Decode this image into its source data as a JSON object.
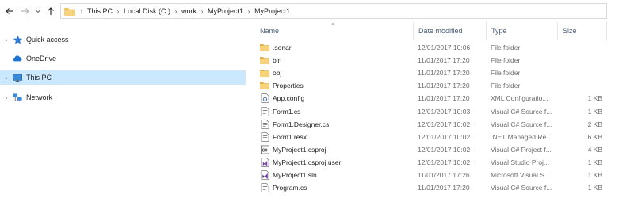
{
  "navigation": {
    "back_icon": "arrow-left-icon",
    "forward_icon": "arrow-right-icon",
    "recent_icon": "chevron-down-icon",
    "up_icon": "arrow-up-icon"
  },
  "breadcrumb": [
    "This PC",
    "Local Disk (C:)",
    "work",
    "MyProject1",
    "MyProject1"
  ],
  "sidebar": {
    "items": [
      {
        "label": "Quick access",
        "icon": "star-icon",
        "selected": false
      },
      {
        "label": "OneDrive",
        "icon": "cloud-icon",
        "selected": false
      },
      {
        "label": "This PC",
        "icon": "monitor-icon",
        "selected": true
      },
      {
        "label": "Network",
        "icon": "network-icon",
        "selected": false
      }
    ]
  },
  "columns": {
    "name": "Name",
    "date": "Date modified",
    "type": "Type",
    "size": "Size"
  },
  "files": [
    {
      "name": ".sonar",
      "date": "12/01/2017 10:06",
      "type": "File folder",
      "size": "",
      "icon": "folder-icon"
    },
    {
      "name": "bin",
      "date": "11/01/2017 17:20",
      "type": "File folder",
      "size": "",
      "icon": "folder-icon"
    },
    {
      "name": "obj",
      "date": "11/01/2017 17:20",
      "type": "File folder",
      "size": "",
      "icon": "folder-icon"
    },
    {
      "name": "Properties",
      "date": "11/01/2017 17:20",
      "type": "File folder",
      "size": "",
      "icon": "folder-icon"
    },
    {
      "name": "App.config",
      "date": "11/01/2017 17:20",
      "type": "XML Configuratio...",
      "size": "1 KB",
      "icon": "config-file-icon"
    },
    {
      "name": "Form1.cs",
      "date": "12/01/2017 10:03",
      "type": "Visual C# Source f...",
      "size": "1 KB",
      "icon": "cs-file-icon"
    },
    {
      "name": "Form1.Designer.cs",
      "date": "12/01/2017 10:02",
      "type": "Visual C# Source f...",
      "size": "2 KB",
      "icon": "cs-file-icon"
    },
    {
      "name": "Form1.resx",
      "date": "12/01/2017 10:02",
      "type": ".NET Managed Re...",
      "size": "6 KB",
      "icon": "resx-file-icon"
    },
    {
      "name": "MyProject1.csproj",
      "date": "12/01/2017 10:02",
      "type": "Visual C# Project f...",
      "size": "4 KB",
      "icon": "csproj-file-icon"
    },
    {
      "name": "MyProject1.csproj.user",
      "date": "12/01/2017 10:02",
      "type": "Visual Studio Proj...",
      "size": "1 KB",
      "icon": "vs-user-file-icon"
    },
    {
      "name": "MyProject1.sln",
      "date": "11/01/2017 17:26",
      "type": "Microsoft Visual S...",
      "size": "1 KB",
      "icon": "sln-file-icon"
    },
    {
      "name": "Program.cs",
      "date": "11/01/2017 17:20",
      "type": "Visual C# Source f...",
      "size": "1 KB",
      "icon": "cs-file-icon"
    }
  ],
  "colors": {
    "selection": "#cce8ff",
    "folder": "#f2c55c",
    "header_text": "#4c607a"
  }
}
